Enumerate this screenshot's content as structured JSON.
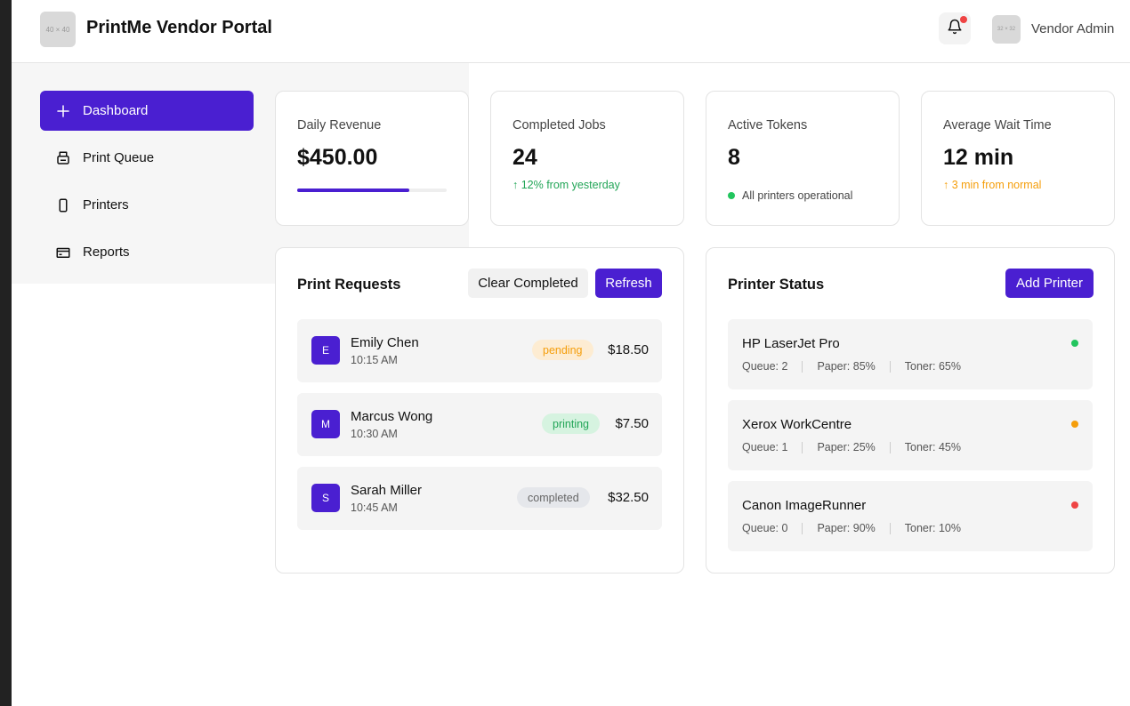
{
  "header": {
    "logo_placeholder": "40 × 40",
    "title": "PrintMe Vendor Portal",
    "notification_icon": "bell-icon",
    "avatar_placeholder": "32 × 32",
    "user_name": "Vendor Admin"
  },
  "sidebar": {
    "items": [
      {
        "label": "Dashboard",
        "icon": "plus-icon",
        "active": true
      },
      {
        "label": "Print Queue",
        "icon": "printer-icon",
        "active": false
      },
      {
        "label": "Printers",
        "icon": "device-icon",
        "active": false
      },
      {
        "label": "Reports",
        "icon": "card-icon",
        "active": false
      }
    ]
  },
  "stats": [
    {
      "label": "Daily Revenue",
      "value": "$450.00",
      "progress": 0.75
    },
    {
      "label": "Completed Jobs",
      "value": "24",
      "note": "↑ 12% from yesterday"
    },
    {
      "label": "Active Tokens",
      "value": "8",
      "note": "All printers operational"
    },
    {
      "label": "Average Wait Time",
      "value": "12 min",
      "note": "↑ 3 min from normal"
    }
  ],
  "print_requests": {
    "title": "Print Requests",
    "clear_label": "Clear Completed",
    "refresh_label": "Refresh",
    "items": [
      {
        "initial": "E",
        "name": "Emily Chen",
        "time": "10:15 AM",
        "status": "pending",
        "amount": "$18.50"
      },
      {
        "initial": "M",
        "name": "Marcus Wong",
        "time": "10:30 AM",
        "status": "printing",
        "amount": "$7.50"
      },
      {
        "initial": "S",
        "name": "Sarah Miller",
        "time": "10:45 AM",
        "status": "completed",
        "amount": "$32.50"
      }
    ]
  },
  "printer_status": {
    "title": "Printer Status",
    "add_label": "Add Printer",
    "items": [
      {
        "name": "HP LaserJet Pro",
        "queue": "Queue: 2",
        "paper": "Paper: 85%",
        "toner": "Toner: 65%",
        "status_color": "#22c55e"
      },
      {
        "name": "Xerox WorkCentre",
        "queue": "Queue: 1",
        "paper": "Paper: 25%",
        "toner": "Toner: 45%",
        "status_color": "#f59e0b"
      },
      {
        "name": "Canon ImageRunner",
        "queue": "Queue: 0",
        "paper": "Paper: 90%",
        "toner": "Toner: 10%",
        "status_color": "#ef4444"
      }
    ]
  },
  "colors": {
    "accent": "#4a1fd1",
    "success": "#22a557",
    "warning": "#f59e0b",
    "danger": "#ef4444"
  }
}
